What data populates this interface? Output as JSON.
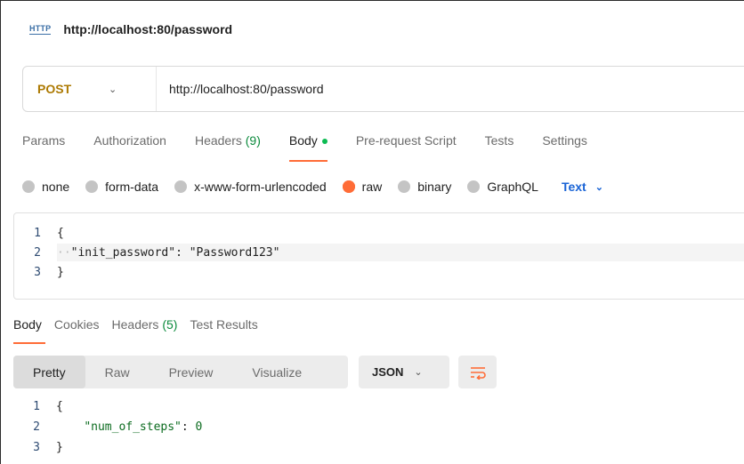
{
  "tab": {
    "http_icon_text": "HTTP",
    "title": "http://localhost:80/password"
  },
  "request": {
    "method": "POST",
    "url": "http://localhost:80/password"
  },
  "request_tabs": [
    {
      "label": "Params"
    },
    {
      "label": "Authorization"
    },
    {
      "label": "Headers",
      "count": "(9)"
    },
    {
      "label": "Body"
    },
    {
      "label": "Pre-request Script"
    },
    {
      "label": "Tests"
    },
    {
      "label": "Settings"
    }
  ],
  "body_types": [
    {
      "label": "none"
    },
    {
      "label": "form-data"
    },
    {
      "label": "x-www-form-urlencoded"
    },
    {
      "label": "raw"
    },
    {
      "label": "binary"
    },
    {
      "label": "GraphQL"
    }
  ],
  "raw_format": "Text",
  "request_body": {
    "lines": [
      {
        "n": "1",
        "text": "{"
      },
      {
        "n": "2",
        "key": "\"init_password\"",
        "sep": ": ",
        "value": "\"Password123\""
      },
      {
        "n": "3",
        "text": "}"
      }
    ]
  },
  "response_tabs": [
    {
      "label": "Body"
    },
    {
      "label": "Cookies"
    },
    {
      "label": "Headers",
      "count": "(5)"
    },
    {
      "label": "Test Results"
    }
  ],
  "response_views": [
    "Pretty",
    "Raw",
    "Preview",
    "Visualize"
  ],
  "response_format": "JSON",
  "response_body": {
    "lines": [
      {
        "n": "1",
        "text": "{"
      },
      {
        "n": "2",
        "key": "\"num_of_steps\"",
        "sep": ": ",
        "value": "0"
      },
      {
        "n": "3",
        "text": "}"
      }
    ]
  },
  "colors": {
    "accent": "#ff6c37",
    "post_method": "#ad7a03",
    "link_blue": "#1a64d6",
    "green": "#0cbb52"
  }
}
